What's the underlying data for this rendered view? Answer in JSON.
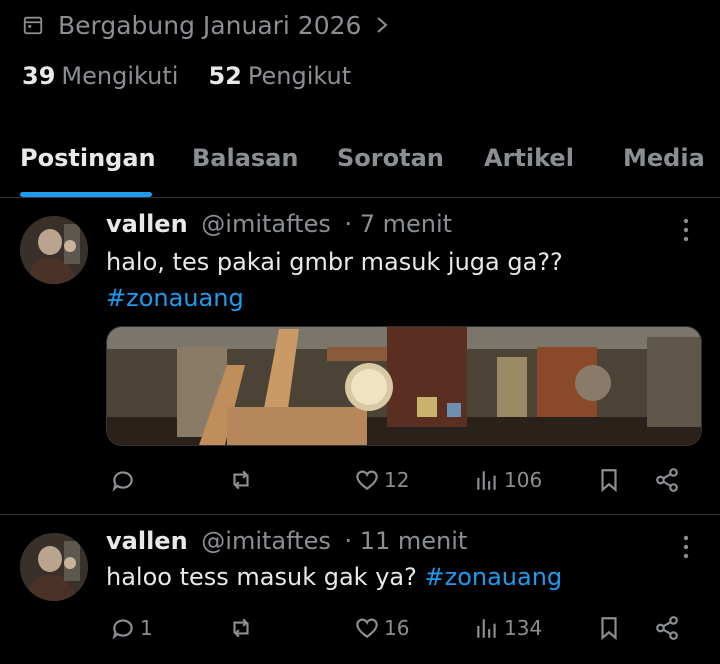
{
  "profile": {
    "joined": "Bergabung Januari 2026",
    "following_count": "39",
    "following_label": "Mengikuti",
    "followers_count": "52",
    "followers_label": "Pengikut"
  },
  "tabs": [
    {
      "label": "Postingan",
      "active": true
    },
    {
      "label": "Balasan"
    },
    {
      "label": "Sorotan"
    },
    {
      "label": "Artikel"
    },
    {
      "label": "Media"
    }
  ],
  "posts": [
    {
      "name": "vallen",
      "handle": "@imitaftes",
      "time": "· 7 menit",
      "text": "halo, tes pakai gmbr masuk juga ga??",
      "hashtag": "#zonauang",
      "replies": "",
      "reposts": "",
      "likes": "12",
      "views": "106"
    },
    {
      "name": "vallen",
      "handle": "@imitaftes",
      "time": "· 11 menit",
      "text": "haloo tess masuk gak ya?",
      "hashtag": "#zonauang",
      "replies": "1",
      "reposts": "",
      "likes": "16",
      "views": "134"
    }
  ],
  "icons": {
    "joined": "calendar-icon",
    "reply": "reply-icon",
    "repost": "repost-icon",
    "like": "heart-icon",
    "views": "views-icon",
    "bookmark": "bookmark-icon",
    "share": "share-icon",
    "more": "more-icon"
  },
  "colors": {
    "accent": "#1d9bf0",
    "muted": "#8b8f93",
    "text": "#e7e9ea",
    "border": "#2f3336"
  }
}
